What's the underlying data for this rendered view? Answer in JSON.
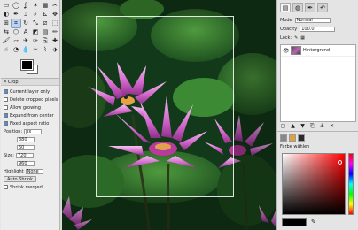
{
  "toolbox": {
    "tools": [
      {
        "name": "rect-select-tool",
        "icon": "▭"
      },
      {
        "name": "ellipse-select-tool",
        "icon": "◯"
      },
      {
        "name": "free-select-tool",
        "icon": "ʆ"
      },
      {
        "name": "fuzzy-select-tool",
        "icon": "✶"
      },
      {
        "name": "color-select-tool",
        "icon": "▦"
      },
      {
        "name": "scissors-tool",
        "icon": "✂"
      },
      {
        "name": "foreground-select-tool",
        "icon": "◐"
      },
      {
        "name": "paths-tool",
        "icon": "✒"
      },
      {
        "name": "color-picker-tool",
        "icon": "⌶"
      },
      {
        "name": "zoom-tool",
        "icon": "⌕"
      },
      {
        "name": "measure-tool",
        "icon": "⊾"
      },
      {
        "name": "move-tool",
        "icon": "✥"
      },
      {
        "name": "align-tool",
        "icon": "⊞"
      },
      {
        "name": "crop-tool",
        "icon": "⌗"
      },
      {
        "name": "rotate-tool",
        "icon": "↻"
      },
      {
        "name": "scale-tool",
        "icon": "⤡"
      },
      {
        "name": "shear-tool",
        "icon": "⧄"
      },
      {
        "name": "perspective-tool",
        "icon": "⬚"
      },
      {
        "name": "flip-tool",
        "icon": "⇆"
      },
      {
        "name": "cage-tool",
        "icon": "⬡"
      },
      {
        "name": "text-tool",
        "icon": "A"
      },
      {
        "name": "bucket-fill-tool",
        "icon": "◩"
      },
      {
        "name": "gradient-tool",
        "icon": "▤"
      },
      {
        "name": "pencil-tool",
        "icon": "✏"
      },
      {
        "name": "paintbrush-tool",
        "icon": "🖌"
      },
      {
        "name": "eraser-tool",
        "icon": "▱"
      },
      {
        "name": "airbrush-tool",
        "icon": "✈"
      },
      {
        "name": "ink-tool",
        "icon": "✑"
      },
      {
        "name": "clone-tool",
        "icon": "⎘"
      },
      {
        "name": "heal-tool",
        "icon": "✚"
      },
      {
        "name": "smudge-tool",
        "icon": "☝"
      },
      {
        "name": "dodge-burn-tool",
        "icon": "◔"
      },
      {
        "name": "blur-tool",
        "icon": "💧"
      },
      {
        "name": "warp-tool",
        "icon": "≈"
      },
      {
        "name": "mypaint-tool",
        "icon": "⌇"
      },
      {
        "name": "unified-transform-tool",
        "icon": "⬗"
      }
    ],
    "active_tool_index": 13,
    "foreground_color": "#000000",
    "background_color": "#ffffff"
  },
  "tool_options": {
    "header": "Crop",
    "rows": [
      {
        "kind": "check",
        "on": true,
        "label": "Current layer only"
      },
      {
        "kind": "check",
        "on": false,
        "label": "Delete cropped pixels"
      },
      {
        "kind": "check",
        "on": false,
        "label": "Allow growing"
      },
      {
        "kind": "check",
        "on": true,
        "label": "Expand from center"
      },
      {
        "kind": "check",
        "on": true,
        "label": "Fixed aspect ratio"
      },
      {
        "kind": "field",
        "label": "Position:",
        "value": "px"
      },
      {
        "kind": "field",
        "label": "",
        "value": "380"
      },
      {
        "kind": "field",
        "label": "",
        "value": "60"
      },
      {
        "kind": "field",
        "label": "Size:",
        "value": "720"
      },
      {
        "kind": "field",
        "label": "",
        "value": "960"
      },
      {
        "kind": "field",
        "label": "Highlight",
        "value": "None"
      },
      {
        "kind": "button",
        "label": "Auto Shrink"
      },
      {
        "kind": "check",
        "on": false,
        "label": "Shrink merged"
      }
    ]
  },
  "layers": {
    "tabs": [
      "layers-tab-icon",
      "channels-tab-icon",
      "paths-tab-icon",
      "undo-tab-icon"
    ],
    "mode_label": "Mode",
    "mode_value": "Normal",
    "opacity_label": "Opacity",
    "opacity_value": "100.0",
    "lock_label": "Lock:",
    "items": [
      {
        "name": "Hintergrund",
        "visible": true
      }
    ],
    "actions": [
      "new-layer-icon",
      "raise-layer-icon",
      "lower-layer-icon",
      "duplicate-layer-icon",
      "anchor-layer-icon",
      "delete-layer-icon"
    ]
  },
  "colors_panel": {
    "label": "Farbe wählen",
    "current_color": "#000000",
    "accent_hue": "#ff0000"
  },
  "canvas": {
    "background": "#123a1a",
    "flower_color": "#c65bc2",
    "leaf_color": "#2f6a2a"
  }
}
